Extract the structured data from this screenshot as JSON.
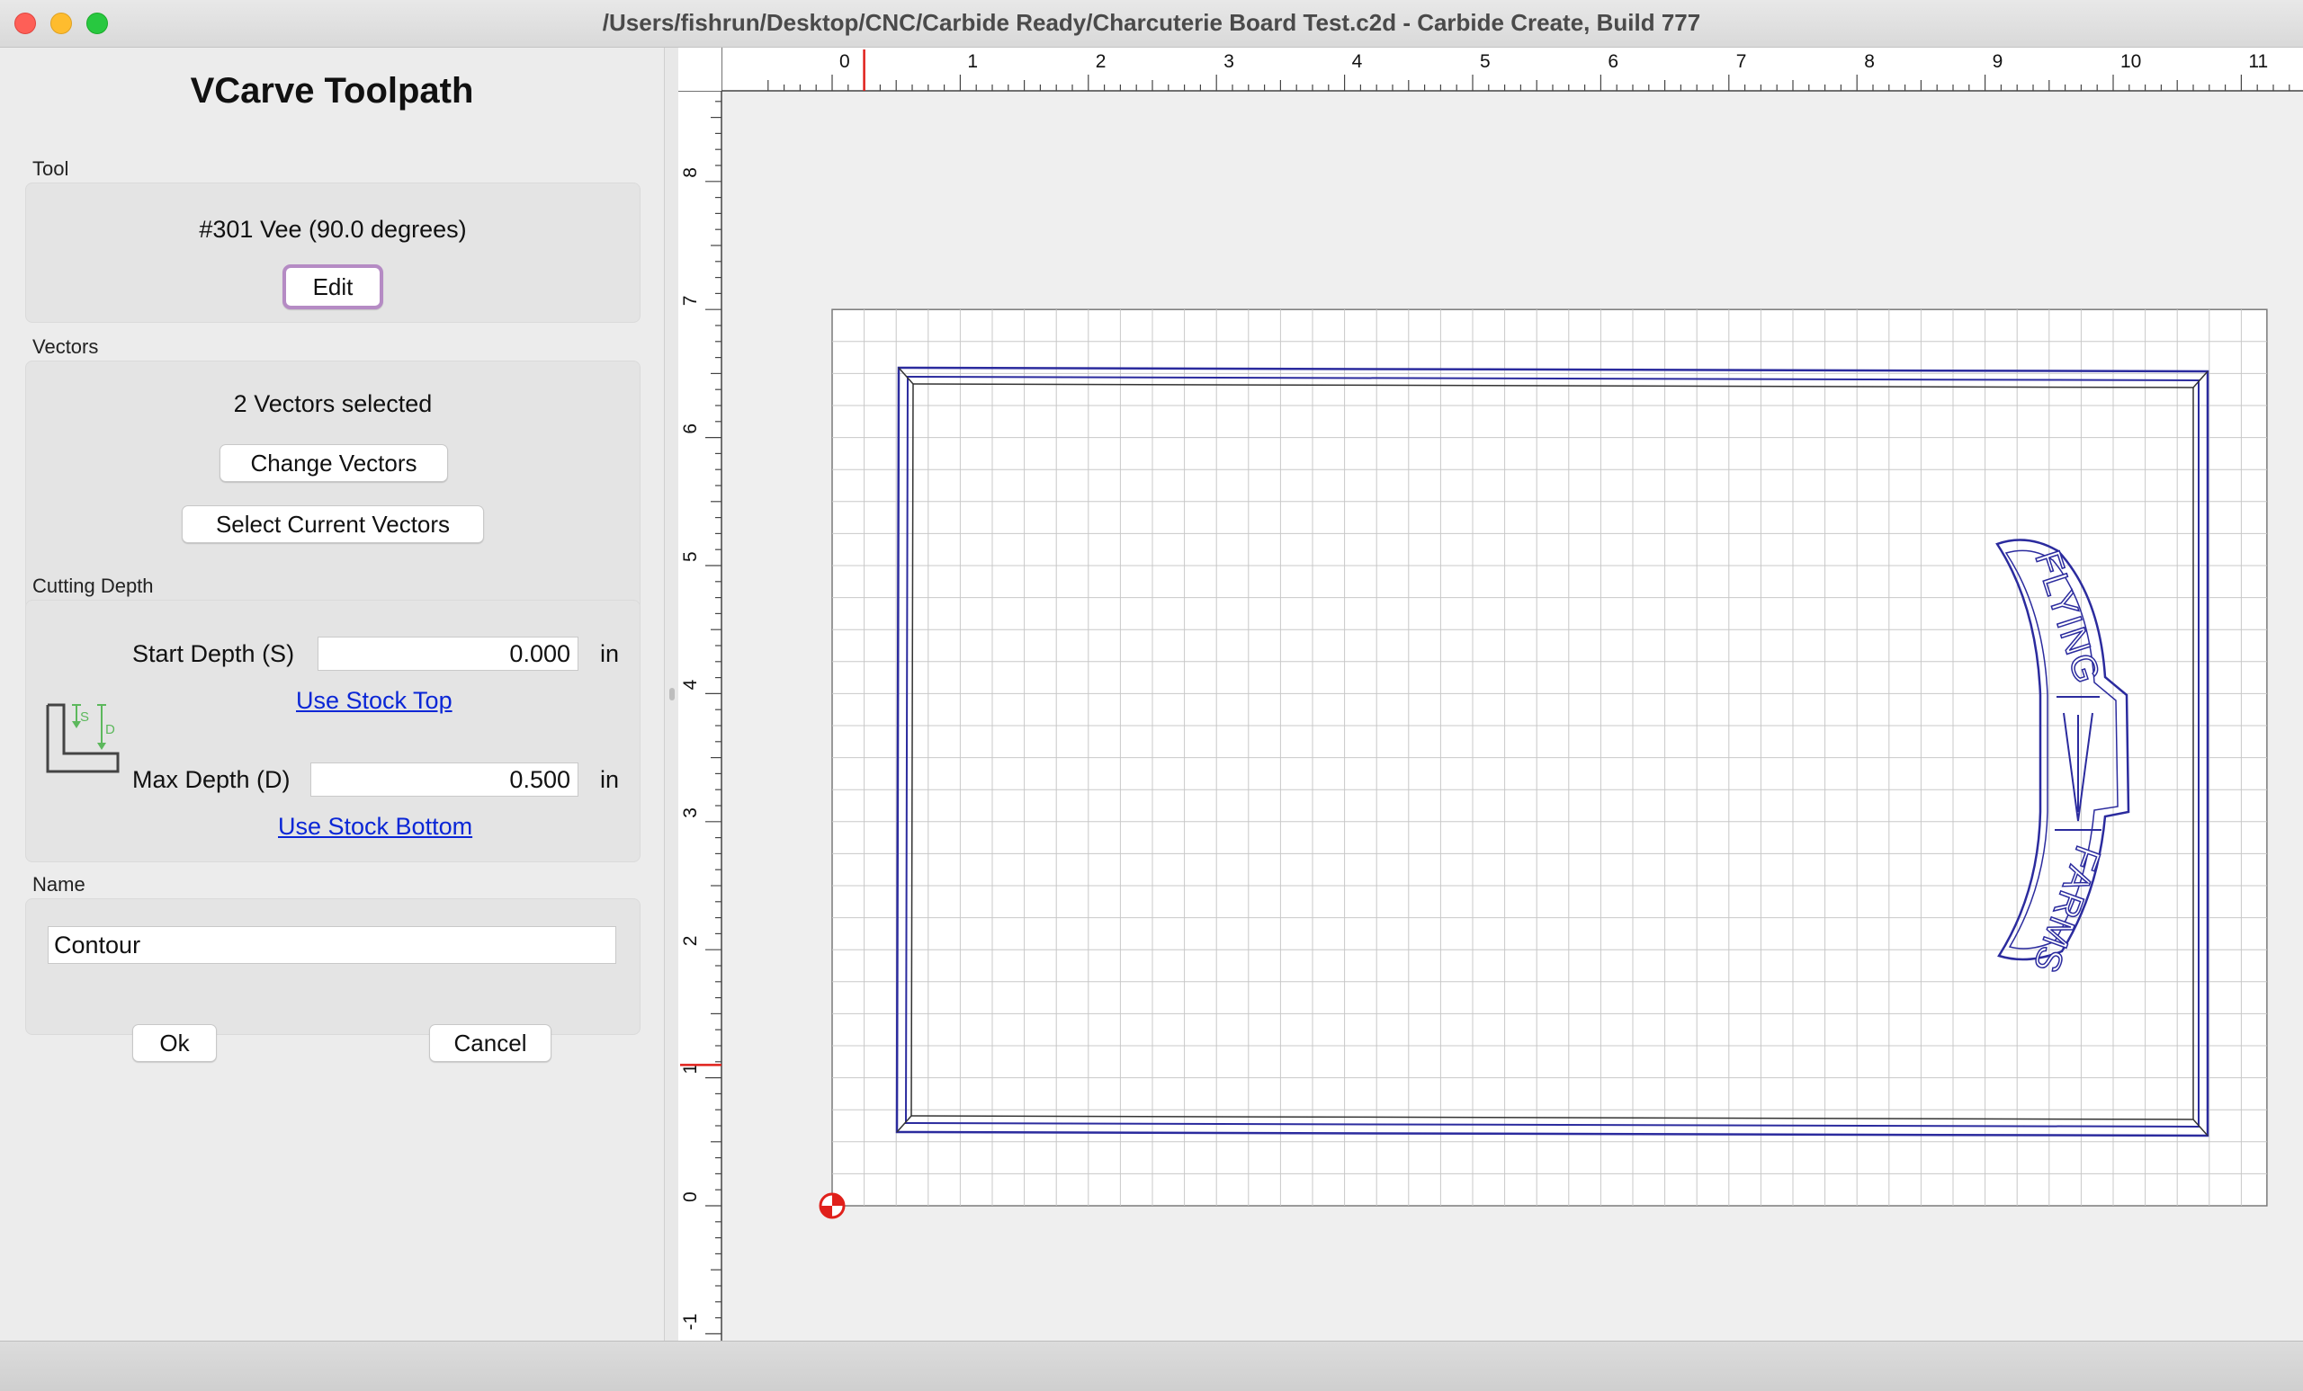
{
  "window": {
    "title": "/Users/fishrun/Desktop/CNC/Carbide Ready/Charcuterie Board Test.c2d - Carbide Create, Build 777"
  },
  "panel": {
    "title": "VCarve Toolpath",
    "tool": {
      "label": "Tool",
      "name": "#301 Vee (90.0 degrees)",
      "edit_label": "Edit"
    },
    "vectors": {
      "label": "Vectors",
      "status": "2 Vectors selected",
      "change_label": "Change Vectors",
      "select_current_label": "Select Current Vectors"
    },
    "cutting_depth": {
      "label": "Cutting Depth",
      "start_label": "Start Depth (S)",
      "start_value": "0.000",
      "start_unit": "in",
      "use_top_label": "Use Stock Top",
      "max_label": "Max Depth (D)",
      "max_value": "0.500",
      "max_unit": "in",
      "use_bottom_label": "Use Stock Bottom",
      "diagram_s": "S",
      "diagram_d": "D"
    },
    "name": {
      "label": "Name",
      "value": "Contour"
    },
    "ok_label": "Ok",
    "cancel_label": "Cancel"
  },
  "canvas": {
    "x_ticks": [
      "0",
      "1",
      "2",
      "3",
      "4",
      "5",
      "6",
      "7",
      "8",
      "9",
      "10",
      "11"
    ],
    "y_ticks": [
      "8",
      "7",
      "6",
      "5",
      "4",
      "3",
      "2",
      "1",
      "0",
      "-1"
    ],
    "stock_width_in": 11.2,
    "stock_height_in": 7.0,
    "cursor_x_in": 0.25,
    "cursor_y_in": 1.1,
    "design_text_top": "FLYING",
    "design_text_bottom": "FARMS",
    "colors": {
      "vector": "#2b2b9e",
      "grid": "#c8c8c8",
      "origin": "#e0201b",
      "cursor": "#e0201b"
    }
  }
}
